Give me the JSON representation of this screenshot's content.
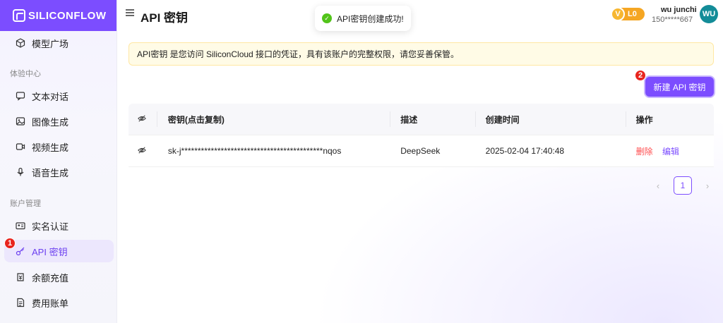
{
  "brand": {
    "name": "SILICONFLOW"
  },
  "sidebar": {
    "top_item": {
      "label": "模型广场",
      "icon": "cube-icon"
    },
    "section_experience": "体验中心",
    "experience_items": [
      {
        "label": "文本对话",
        "icon": "chat-icon"
      },
      {
        "label": "图像生成",
        "icon": "image-icon"
      },
      {
        "label": "视频生成",
        "icon": "video-icon"
      },
      {
        "label": "语音生成",
        "icon": "mic-icon"
      }
    ],
    "section_account": "账户管理",
    "account_items": [
      {
        "label": "实名认证",
        "icon": "id-card-icon"
      },
      {
        "label": "API 密钥",
        "icon": "key-icon",
        "active": true
      },
      {
        "label": "余额充值",
        "icon": "wallet-icon"
      },
      {
        "label": "费用账单",
        "icon": "bill-icon"
      }
    ],
    "badge": "1"
  },
  "header": {
    "title": "API 密钥",
    "toast": "API密钥创建成功!",
    "level": "L0",
    "level_mark": "V",
    "user_name": "wu junchi",
    "user_phone": "150*****667",
    "avatar": "WU"
  },
  "notice": "API密钥 是您访问 SiliconCloud 接口的凭证，具有该账户的完整权限，请您妥善保管。",
  "new_button": {
    "label": "新建 API 密钥",
    "badge": "2"
  },
  "table": {
    "headers": [
      "密钥(点击复制)",
      "描述",
      "创建时间",
      "操作"
    ],
    "rows": [
      {
        "key": "sk-j*******************************************nqos",
        "description": "DeepSeek",
        "created": "2025-02-04 17:40:48",
        "delete": "删除",
        "edit": "编辑"
      }
    ]
  },
  "pagination": {
    "current": "1",
    "prev": "‹",
    "next": "›"
  },
  "colors": {
    "accent": "#7c4dff",
    "danger": "#ff4d4f",
    "success": "#52c41a",
    "level": "#f5a623",
    "avatar": "#138c98"
  }
}
